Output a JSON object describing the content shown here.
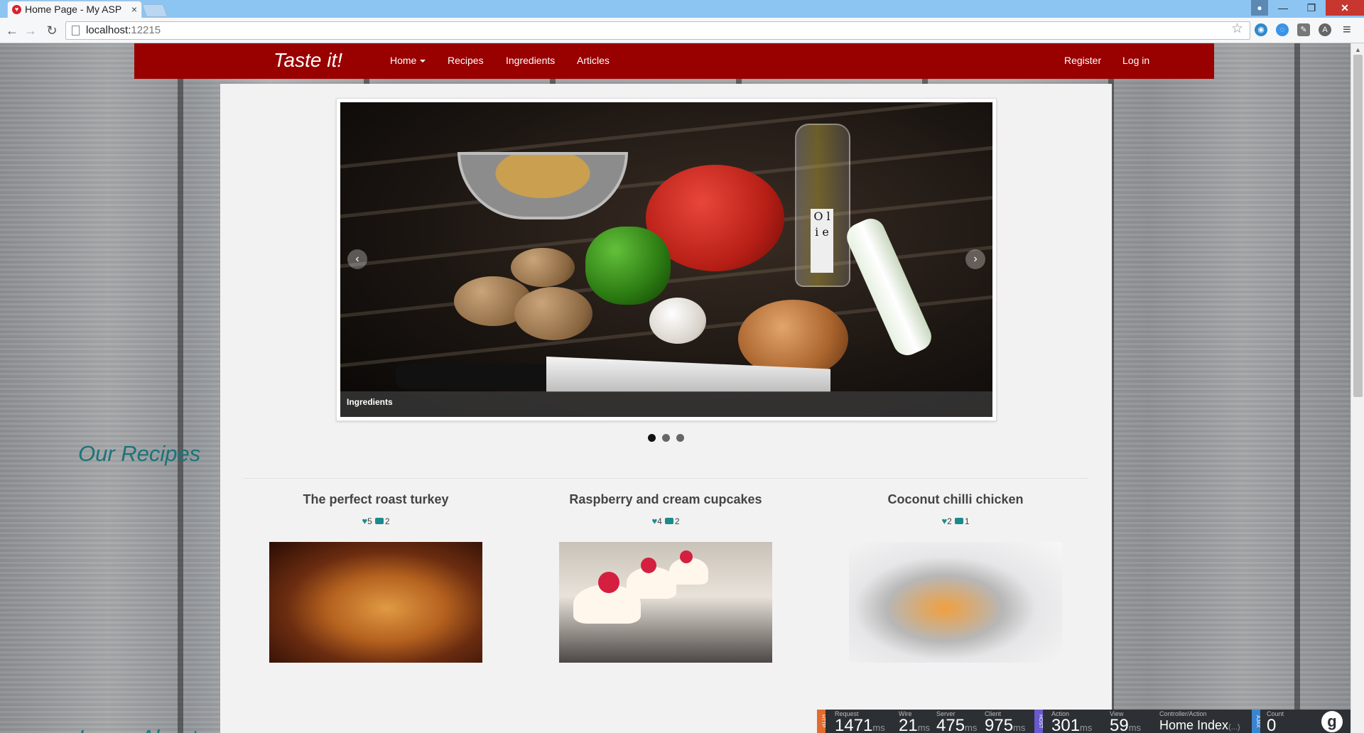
{
  "browser": {
    "tab_title": "Home Page - My ASP",
    "url_host": "localhost:",
    "url_port": "12215"
  },
  "site": {
    "brand": "Taste it!",
    "nav": {
      "home": "Home",
      "recipes": "Recipes",
      "ingredients": "Ingredients",
      "articles": "Articles",
      "register": "Register",
      "login": "Log in"
    },
    "carousel": {
      "caption": "Ingredients",
      "slide_count": 3,
      "active_slide": 1
    },
    "our_recipes": {
      "title": "Our Recipes",
      "items": [
        {
          "title": "The perfect roast turkey",
          "likes": "5",
          "comments": "2"
        },
        {
          "title": "Raspberry and cream cupcakes",
          "likes": "4",
          "comments": "2"
        },
        {
          "title": "Coconut chilli chicken",
          "likes": "2",
          "comments": "1"
        }
      ]
    },
    "next_section_title": "Learn About"
  },
  "glimpse": {
    "tags": {
      "http": "HTTP",
      "host": "HOST",
      "ajax": "AJAX"
    },
    "metrics": [
      {
        "label": "Request",
        "value": "1471",
        "unit": "ms"
      },
      {
        "label": "Wire",
        "value": "21",
        "unit": "ms"
      },
      {
        "label": "Server",
        "value": "475",
        "unit": "ms"
      },
      {
        "label": "Client",
        "value": "975",
        "unit": "ms"
      },
      {
        "label": "Action",
        "value": "301",
        "unit": "ms"
      },
      {
        "label": "View",
        "value": "59",
        "unit": "ms"
      },
      {
        "label": "Controller/Action",
        "value": "Home Index",
        "unit": "(...)"
      },
      {
        "label": "Count",
        "value": "0",
        "unit": ""
      }
    ]
  },
  "icons": {
    "tab_favicon": "heart-favicon",
    "page": "page-icon",
    "star": "bookmark-star-icon",
    "menu": "hamburger-icon"
  }
}
